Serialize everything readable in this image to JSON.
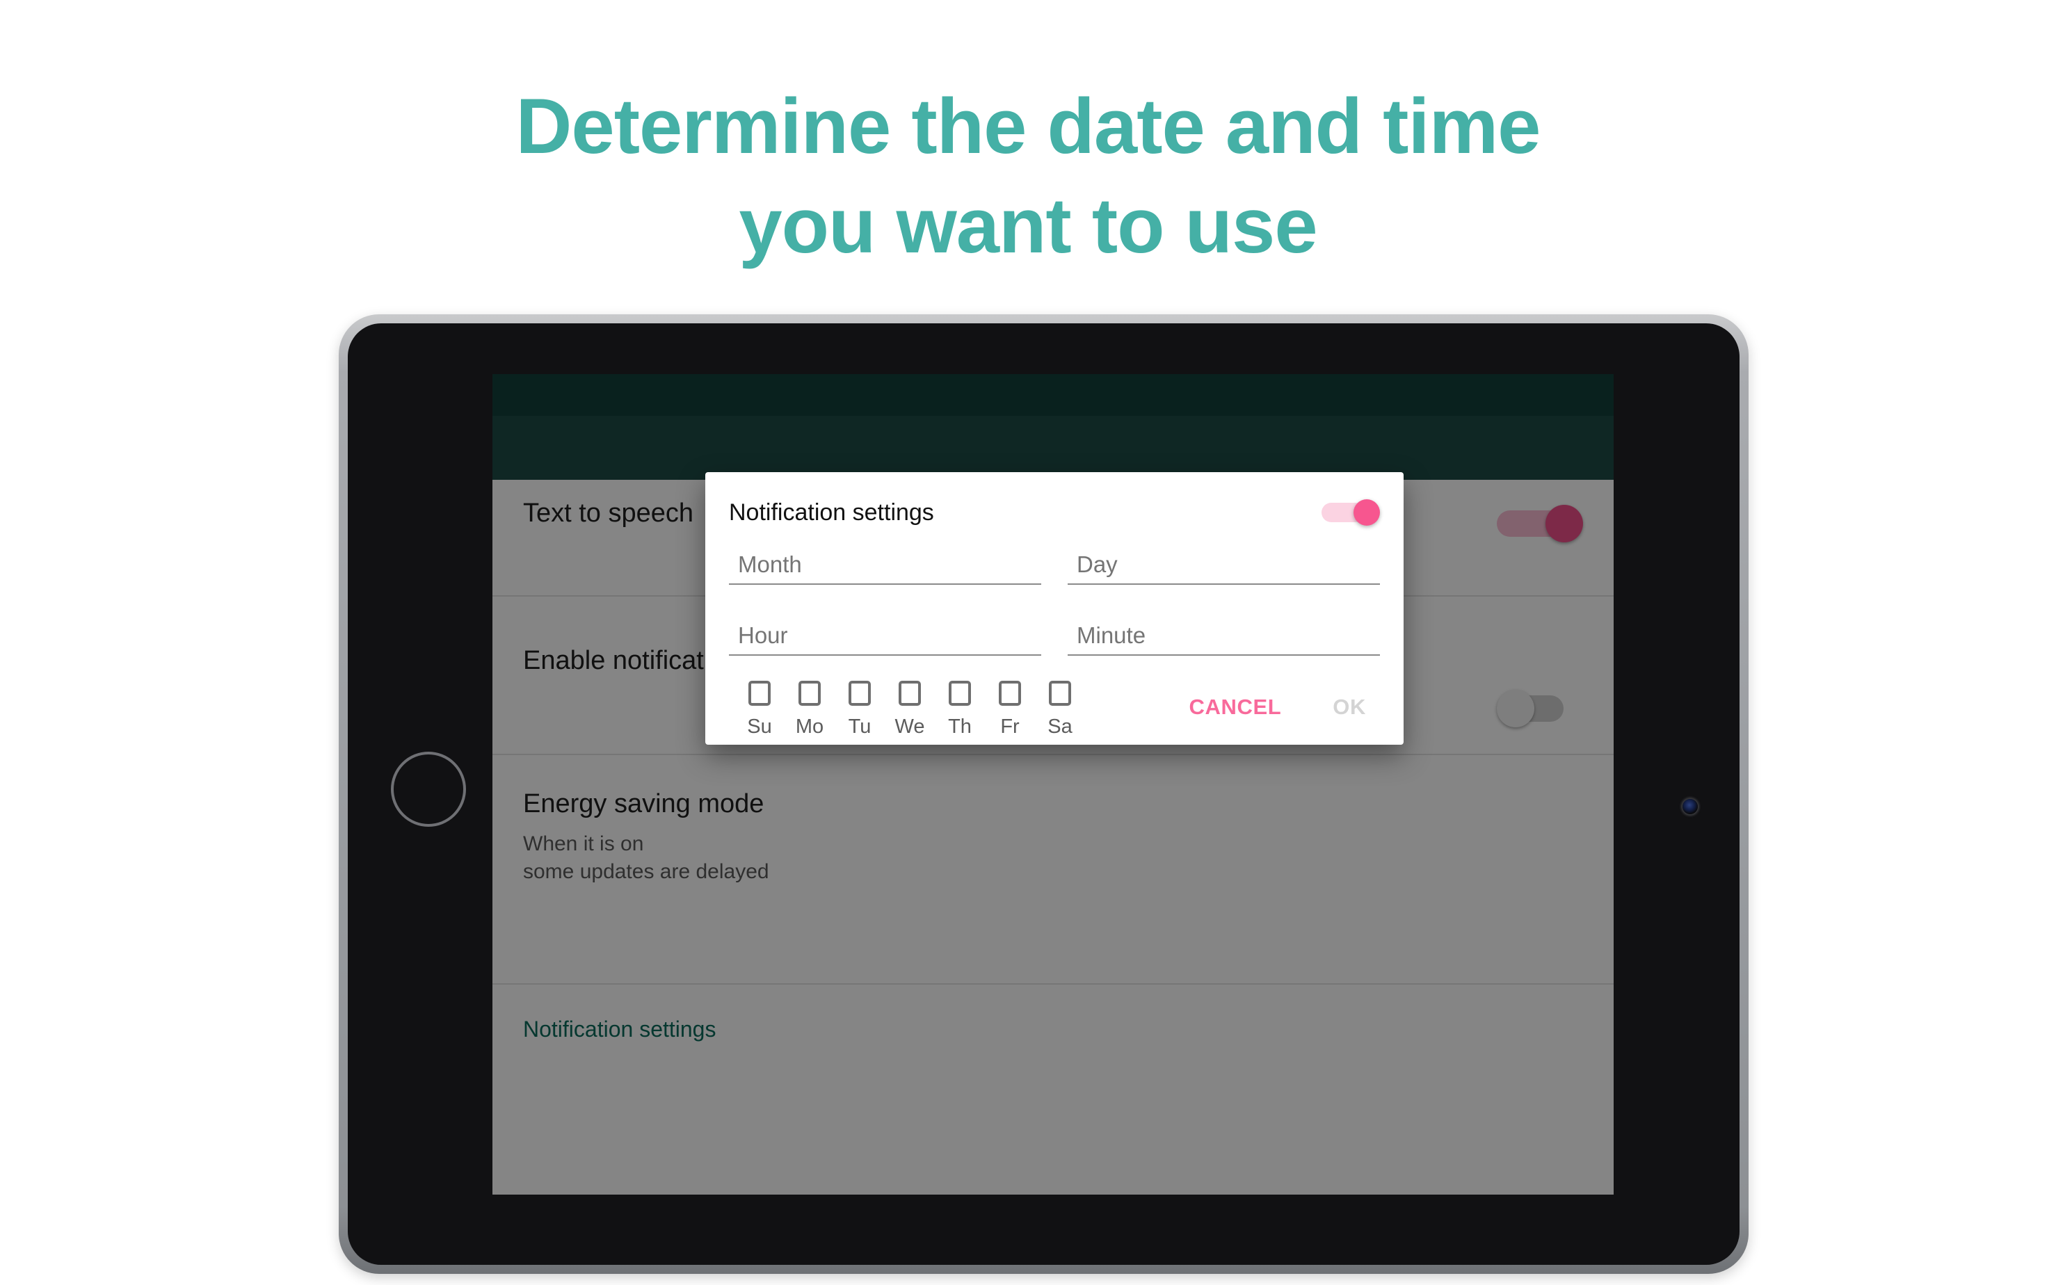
{
  "headline": {
    "text": "Determine the date and time\nyou want to use",
    "color": "#45b0a6"
  },
  "device": {
    "name": "tablet",
    "home_button": "home-button",
    "front_camera": "front-camera"
  },
  "app_background": {
    "status_bar_color": "#12403b",
    "app_bar_color": "#1d4b45",
    "rows": [
      {
        "title": "Text to speech",
        "subtitle": "",
        "link": ""
      },
      {
        "title": "Enable notifications",
        "subtitle": "",
        "link": ""
      },
      {
        "title": "Energy saving mode",
        "subtitle": "When it is on\nsome updates are delayed",
        "link": ""
      },
      {
        "title": "",
        "subtitle": "",
        "link": "Notification settings"
      }
    ],
    "switches": [
      {
        "name": "enable-notifications-switch",
        "state": "on"
      },
      {
        "name": "energy-saving-switch",
        "state": "off"
      }
    ]
  },
  "dialog": {
    "title": "Notification settings",
    "enabled_toggle": {
      "name": "notification-enabled-toggle",
      "state": "on",
      "track_color": "#fbd3e2",
      "thumb_color": "#f7568f"
    },
    "fields": [
      {
        "name": "month-input",
        "placeholder": "Month",
        "value": ""
      },
      {
        "name": "day-input",
        "placeholder": "Day",
        "value": ""
      },
      {
        "name": "hour-input",
        "placeholder": "Hour",
        "value": ""
      },
      {
        "name": "minute-input",
        "placeholder": "Minute",
        "value": ""
      }
    ],
    "weekdays": [
      {
        "label": "Su",
        "checked": false
      },
      {
        "label": "Mo",
        "checked": false
      },
      {
        "label": "Tu",
        "checked": false
      },
      {
        "label": "We",
        "checked": false
      },
      {
        "label": "Th",
        "checked": false
      },
      {
        "label": "Fr",
        "checked": false
      },
      {
        "label": "Sa",
        "checked": false
      }
    ],
    "buttons": {
      "cancel": {
        "label": "CANCEL",
        "color": "#f86a9b",
        "enabled": true
      },
      "ok": {
        "label": "OK",
        "color": "#d4d4d4",
        "enabled": false
      }
    }
  }
}
